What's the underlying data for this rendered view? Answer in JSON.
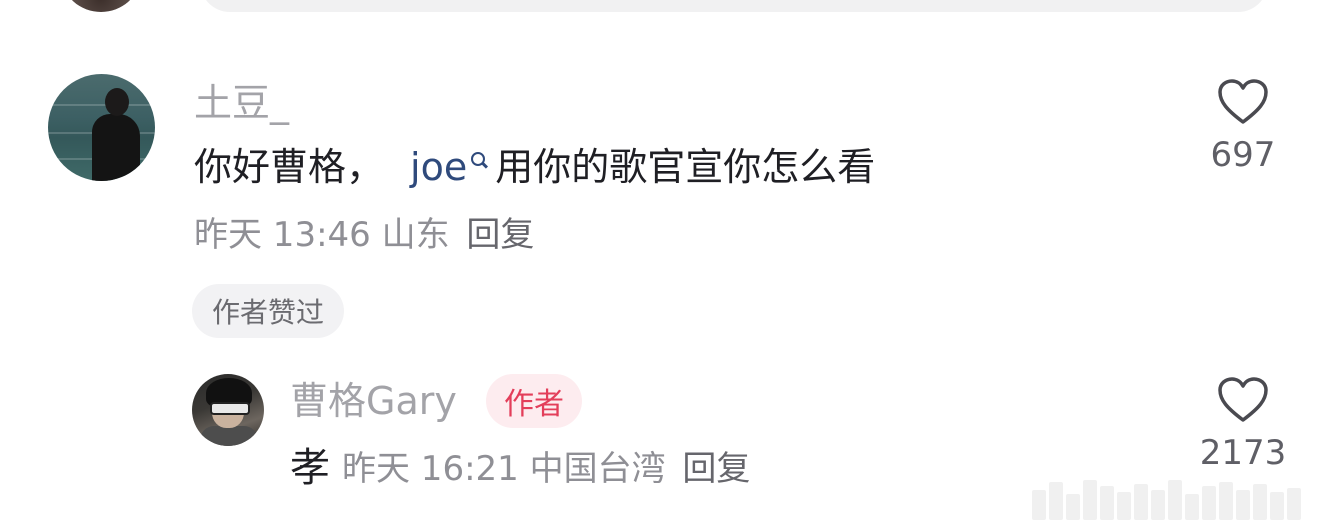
{
  "comments": [
    {
      "username": "土豆_",
      "text_before": "你好曹格，",
      "mention": "joe",
      "text_after": "用你的歌官宣你怎么看",
      "time": "昨天 13:46",
      "location": "山东",
      "reply_label": "回复",
      "liked_by_author": "作者赞过",
      "like_count": "697"
    }
  ],
  "reply": {
    "username": "曹格Gary",
    "author_badge": "作者",
    "text": "孝",
    "time": "昨天 16:21",
    "location": "中国台湾",
    "reply_label": "回复",
    "like_count": "2173"
  },
  "icons": {
    "like": "heart-outline-icon",
    "mention": "search-icon"
  },
  "colors": {
    "username": "#a3a3a8",
    "mention": "#2f4a7c",
    "author_badge_text": "#e33e5a",
    "author_badge_bg": "#fdecef"
  }
}
